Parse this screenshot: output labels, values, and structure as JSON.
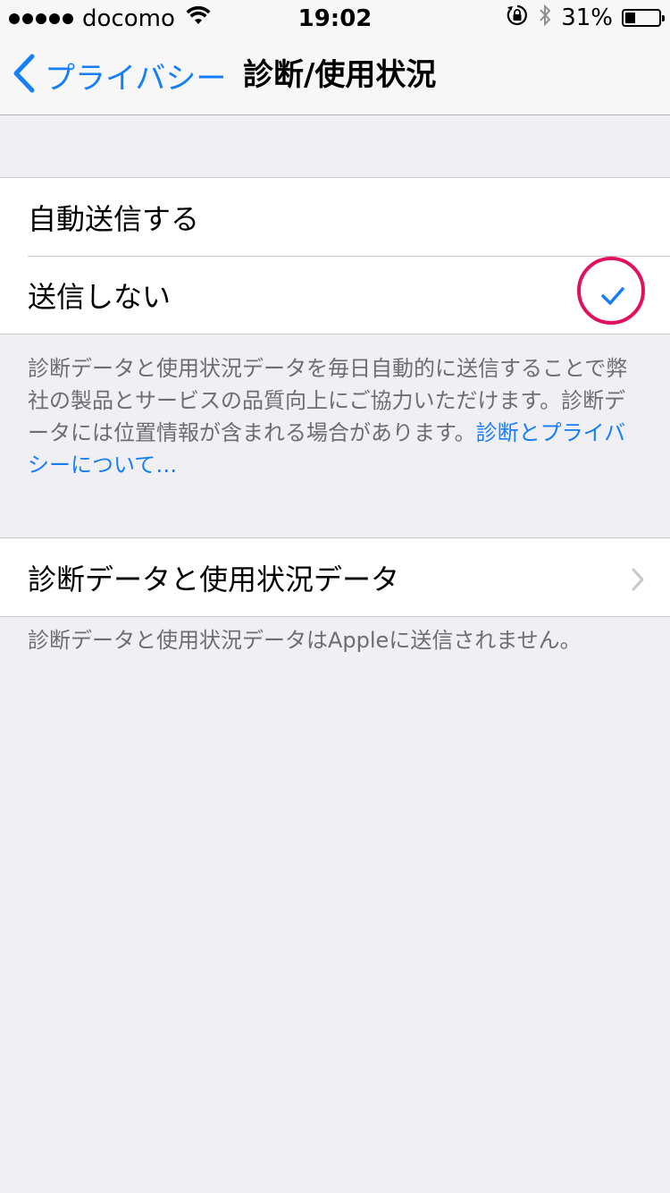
{
  "status_bar": {
    "carrier": "docomo",
    "time": "19:02",
    "battery_percent": "31%",
    "battery_level": 0.31,
    "icons": [
      "signal-dots",
      "wifi-icon",
      "rotation-lock-icon",
      "bluetooth-icon",
      "battery-icon"
    ]
  },
  "nav": {
    "back_label": "プライバシー",
    "title": "診断/使用状況"
  },
  "options": {
    "auto_send": "自動送信する",
    "dont_send": "送信しない",
    "selected": "dont_send"
  },
  "description": {
    "text": "診断データと使用状況データを毎日自動的に送信することで弊社の製品とサービスの品質向上にご協力いただけます。診断データには位置情報が含まれる場合があります。",
    "link": "診断とプライバシーについて…"
  },
  "data_row": {
    "label": "診断データと使用状況データ"
  },
  "data_footer": {
    "text": "診断データと使用状況データはAppleに送信されません。"
  },
  "colors": {
    "accent": "#157efb",
    "highlight": "#e0115f",
    "background": "#efeff4"
  }
}
